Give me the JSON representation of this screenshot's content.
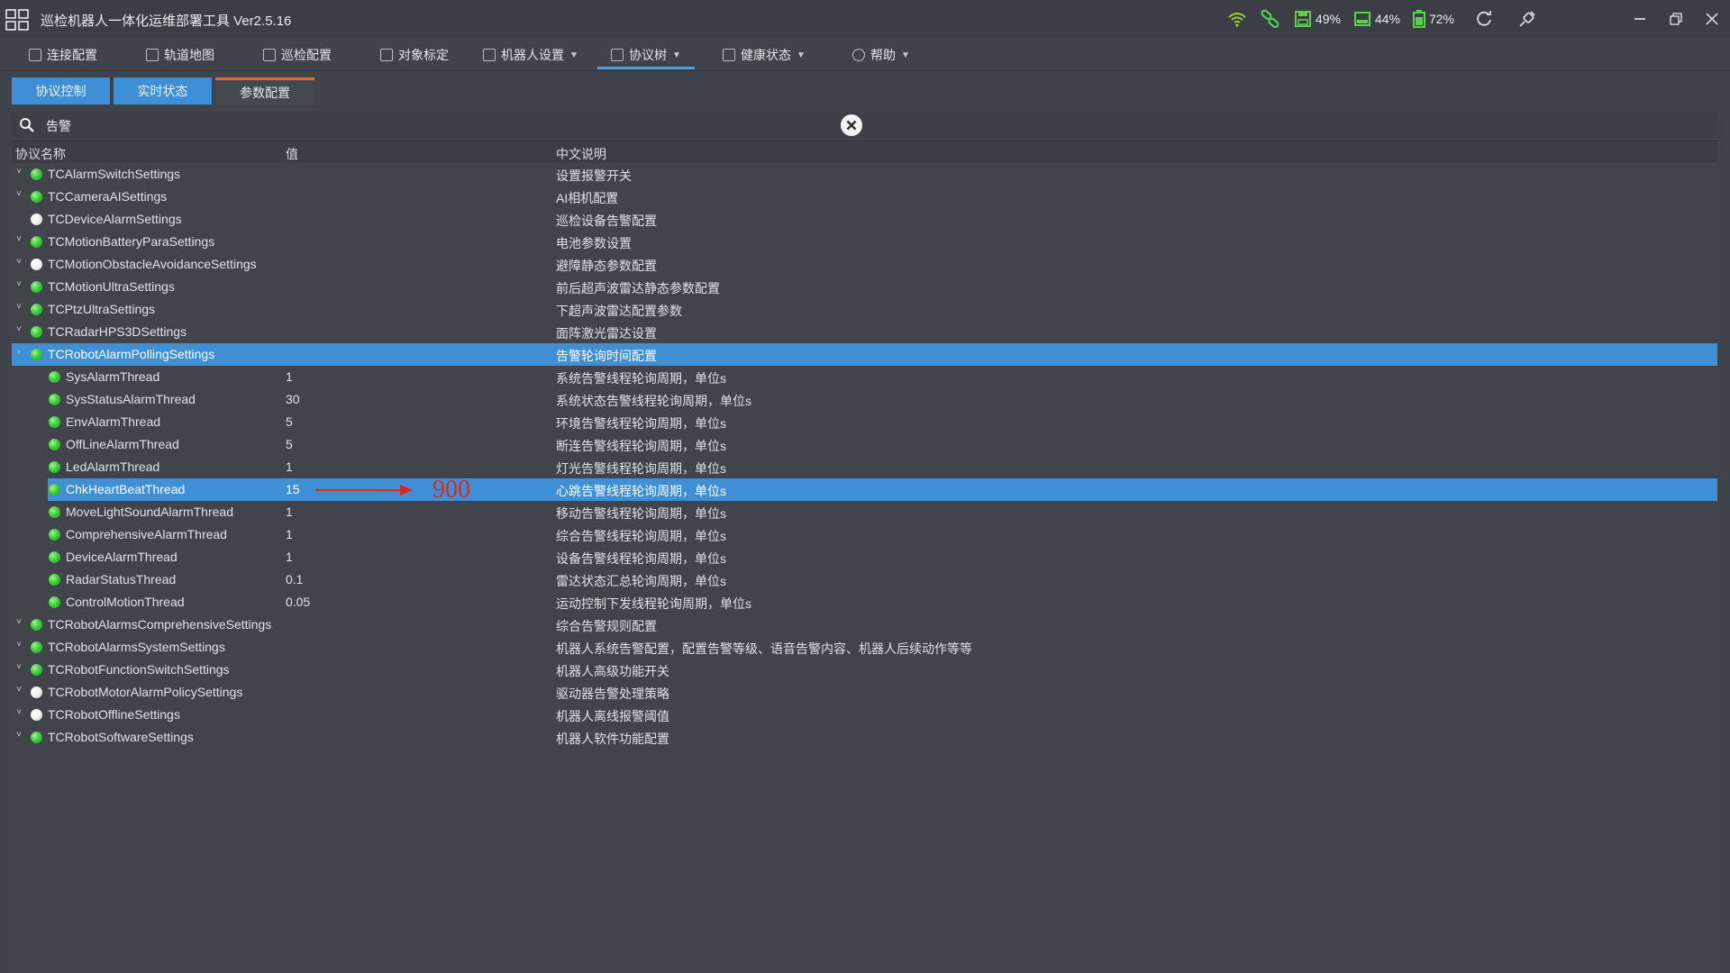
{
  "window": {
    "title": "巡检机器人一体化运维部署工具  Ver2.5.16",
    "status": [
      {
        "icon": "wifi-icon",
        "text": ""
      },
      {
        "icon": "link-icon",
        "text": ""
      },
      {
        "icon": "disk-icon",
        "text": "49%"
      },
      {
        "icon": "memory-icon",
        "text": "44%"
      },
      {
        "icon": "battery-icon",
        "text": "72%"
      }
    ]
  },
  "menu": [
    {
      "label": "连接配置",
      "icon": "connection-icon",
      "has_caret": false
    },
    {
      "label": "轨道地图",
      "icon": "map-icon",
      "has_caret": false
    },
    {
      "label": "巡检配置",
      "icon": "patrol-icon",
      "has_caret": false
    },
    {
      "label": "对象标定",
      "icon": "target-icon",
      "has_caret": false
    },
    {
      "label": "机器人设置",
      "icon": "robot-icon",
      "has_caret": true
    },
    {
      "label": "协议树",
      "icon": "tree-icon",
      "has_caret": true
    },
    {
      "label": "健康状态",
      "icon": "health-icon",
      "has_caret": true
    },
    {
      "label": "帮助",
      "icon": "help-icon",
      "has_caret": true
    }
  ],
  "subtabs": [
    "协议控制",
    "实时状态",
    "参数配置"
  ],
  "search": {
    "value": "告警",
    "placeholder": ""
  },
  "table": {
    "headers": [
      "协议名称",
      "值",
      "中文说明"
    ],
    "rows": [
      {
        "level": 0,
        "toggle": "˅",
        "dot": "green",
        "name": "TCAlarmSwitchSettings",
        "value": "",
        "desc": "设置报警开关"
      },
      {
        "level": 0,
        "toggle": "˅",
        "dot": "green",
        "name": "TCCameraAISettings",
        "value": "",
        "desc": "AI相机配置"
      },
      {
        "level": 0,
        "toggle": "",
        "dot": "white",
        "name": "TCDeviceAlarmSettings",
        "value": "",
        "desc": "巡检设备告警配置"
      },
      {
        "level": 0,
        "toggle": "˅",
        "dot": "green",
        "name": "TCMotionBatteryParaSettings",
        "value": "",
        "desc": "电池参数设置"
      },
      {
        "level": 0,
        "toggle": "˅",
        "dot": "white",
        "name": "TCMotionObstacleAvoidanceSettings",
        "value": "",
        "desc": "避障静态参数配置"
      },
      {
        "level": 0,
        "toggle": "˅",
        "dot": "green",
        "name": "TCMotionUltraSettings",
        "value": "",
        "desc": "前后超声波雷达静态参数配置"
      },
      {
        "level": 0,
        "toggle": "˅",
        "dot": "green",
        "name": "TCPtzUltraSettings",
        "value": "",
        "desc": "下超声波雷达配置参数"
      },
      {
        "level": 0,
        "toggle": "˅",
        "dot": "green",
        "name": "TCRadarHPS3DSettings",
        "value": "",
        "desc": "面阵激光雷达设置"
      },
      {
        "level": 0,
        "toggle": "›",
        "dot": "green",
        "name": "TCRobotAlarmPollingSettings",
        "value": "",
        "desc": "告警轮询时间配置",
        "selected": true
      },
      {
        "level": 1,
        "toggle": "",
        "dot": "green",
        "name": "SysAlarmThread",
        "value": "1",
        "desc": "系统告警线程轮询周期，单位s"
      },
      {
        "level": 1,
        "toggle": "",
        "dot": "green",
        "name": "SysStatusAlarmThread",
        "value": "30",
        "desc": "系统状态告警线程轮询周期，单位s"
      },
      {
        "level": 1,
        "toggle": "",
        "dot": "green",
        "name": "EnvAlarmThread",
        "value": "5",
        "desc": "环境告警线程轮询周期，单位s"
      },
      {
        "level": 1,
        "toggle": "",
        "dot": "green",
        "name": "OffLineAlarmThread",
        "value": "5",
        "desc": "断连告警线程轮询周期，单位s"
      },
      {
        "level": 1,
        "toggle": "",
        "dot": "green",
        "name": "LedAlarmThread",
        "value": "1",
        "desc": "灯光告警线程轮询周期，单位s"
      },
      {
        "level": 1,
        "toggle": "",
        "dot": "green",
        "name": "ChkHeartBeatThread",
        "value": "15",
        "desc": "心跳告警线程轮询周期，单位s",
        "selected": true,
        "annotation": "900"
      },
      {
        "level": 1,
        "toggle": "",
        "dot": "green",
        "name": "MoveLightSoundAlarmThread",
        "value": "1",
        "desc": "移动告警线程轮询周期，单位s"
      },
      {
        "level": 1,
        "toggle": "",
        "dot": "green",
        "name": "ComprehensiveAlarmThread",
        "value": "1",
        "desc": "综合告警线程轮询周期，单位s"
      },
      {
        "level": 1,
        "toggle": "",
        "dot": "green",
        "name": "DeviceAlarmThread",
        "value": "1",
        "desc": "设备告警线程轮询周期，单位s"
      },
      {
        "level": 1,
        "toggle": "",
        "dot": "green",
        "name": "RadarStatusThread",
        "value": "0.1",
        "desc": "雷达状态汇总轮询周期，单位s"
      },
      {
        "level": 1,
        "toggle": "",
        "dot": "green",
        "name": "ControlMotionThread",
        "value": "0.05",
        "desc": "运动控制下发线程轮询周期，单位s"
      },
      {
        "level": 0,
        "toggle": "˅",
        "dot": "green",
        "name": "TCRobotAlarmsComprehensiveSettings",
        "value": "",
        "desc": "综合告警规则配置"
      },
      {
        "level": 0,
        "toggle": "˅",
        "dot": "green",
        "name": "TCRobotAlarmsSystemSettings",
        "value": "",
        "desc": "机器人系统告警配置，配置告警等级、语音告警内容、机器人后续动作等等"
      },
      {
        "level": 0,
        "toggle": "˅",
        "dot": "green",
        "name": "TCRobotFunctionSwitchSettings",
        "value": "",
        "desc": "机器人高级功能开关"
      },
      {
        "level": 0,
        "toggle": "˅",
        "dot": "white",
        "name": "TCRobotMotorAlarmPolicySettings",
        "value": "",
        "desc": "驱动器告警处理策略"
      },
      {
        "level": 0,
        "toggle": "˅",
        "dot": "white",
        "name": "TCRobotOfflineSettings",
        "value": "",
        "desc": "机器人离线报警阈值"
      },
      {
        "level": 0,
        "toggle": "˅",
        "dot": "green",
        "name": "TCRobotSoftwareSettings",
        "value": "",
        "desc": "机器人软件功能配置"
      }
    ]
  }
}
